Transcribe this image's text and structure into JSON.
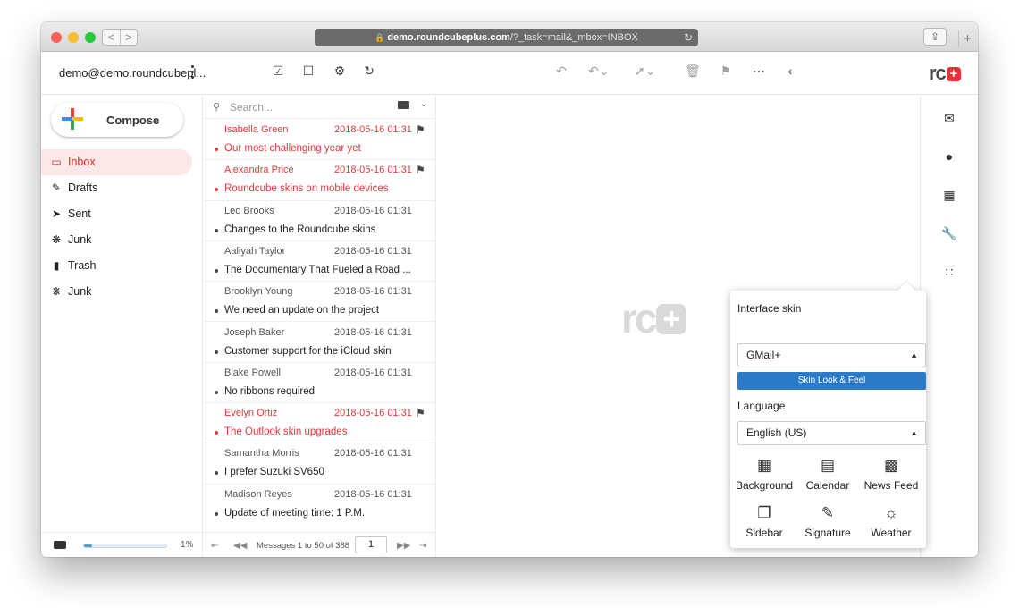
{
  "browser": {
    "url_host": "demo.roundcubeplus.com",
    "url_path": "/?_task=mail&_mbox=INBOX",
    "back_glyph": "<",
    "forward_glyph": ">",
    "new_tab_glyph": "+"
  },
  "toolbar": {
    "account": "demo@demo.roundcubepl...",
    "logo_text": "rc",
    "logo_plus": "+"
  },
  "sidebar": {
    "compose_label": "Compose",
    "folders": [
      {
        "label": "Inbox",
        "icon": "inbox-icon",
        "active": true
      },
      {
        "label": "Drafts",
        "icon": "pencil-icon",
        "active": false
      },
      {
        "label": "Sent",
        "icon": "send-icon",
        "active": false
      },
      {
        "label": "Junk",
        "icon": "junk-icon",
        "active": false
      },
      {
        "label": "Trash",
        "icon": "trash-icon",
        "active": false
      },
      {
        "label": "Junk",
        "icon": "junk-icon",
        "active": false
      }
    ],
    "quota_percent": "1%"
  },
  "list": {
    "search_placeholder": "Search...",
    "messages": [
      {
        "from": "Isabella Green",
        "date": "2018-05-16 01:31",
        "subject": "Our most challenging year yet",
        "flagged": true
      },
      {
        "from": "Alexandra Price",
        "date": "2018-05-16 01:31",
        "subject": "Roundcube skins on mobile devices",
        "flagged": true
      },
      {
        "from": "Leo Brooks",
        "date": "2018-05-16 01:31",
        "subject": "Changes to the Roundcube skins",
        "flagged": false
      },
      {
        "from": "Aaliyah Taylor",
        "date": "2018-05-16 01:31",
        "subject": "The Documentary That Fueled a Road ...",
        "flagged": false
      },
      {
        "from": "Brooklyn Young",
        "date": "2018-05-16 01:31",
        "subject": "We need an update on the project",
        "flagged": false
      },
      {
        "from": "Joseph Baker",
        "date": "2018-05-16 01:31",
        "subject": "Customer support for the iCloud skin",
        "flagged": false
      },
      {
        "from": "Blake Powell",
        "date": "2018-05-16 01:31",
        "subject": "No ribbons required",
        "flagged": false
      },
      {
        "from": "Evelyn Ortiz",
        "date": "2018-05-16 01:31",
        "subject": "The Outlook skin upgrades",
        "flagged": true
      },
      {
        "from": "Samantha Morris",
        "date": "2018-05-16 01:31",
        "subject": "I prefer Suzuki SV650",
        "flagged": false
      },
      {
        "from": "Madison Reyes",
        "date": "2018-05-16 01:31",
        "subject": "Update of meeting time: 1 P.M.",
        "flagged": false
      }
    ],
    "pager_info": "Messages 1 to 50 of 388",
    "page_number": "1"
  },
  "content": {
    "watermark_text": "rc",
    "watermark_plus": "+"
  },
  "popover": {
    "skin_title": "Interface skin",
    "skin_value": "GMail+",
    "skin_button": "Skin Look & Feel",
    "language_title": "Language",
    "language_value": "English (US)",
    "widgets": [
      {
        "label": "Background",
        "icon": "image-icon"
      },
      {
        "label": "Calendar",
        "icon": "calendar-icon"
      },
      {
        "label": "News Feed",
        "icon": "newspaper-icon"
      },
      {
        "label": "Sidebar",
        "icon": "sidebar-icon"
      },
      {
        "label": "Signature",
        "icon": "signature-icon"
      },
      {
        "label": "Weather",
        "icon": "weather-icon"
      }
    ]
  },
  "colors": {
    "accent_red": "#e5373c",
    "active_bg": "#fce8e9",
    "button_blue": "#2c7bc6"
  }
}
